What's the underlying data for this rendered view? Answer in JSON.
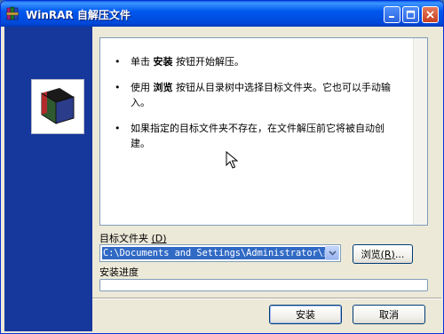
{
  "window": {
    "title": "WinRAR 自解压文件",
    "accent": "#0058ee",
    "panel_color": "#16389c",
    "icons": {
      "app": "winrar-books-icon",
      "minimize": "minimize-icon",
      "maximize": "maximize-icon",
      "close": "close-icon",
      "logo": "winrar-box-logo"
    }
  },
  "info": {
    "bullet": "•",
    "items": [
      {
        "before": "单击 ",
        "bold": "安装",
        "after": " 按钮开始解压。"
      },
      {
        "before": "使用 ",
        "bold": "浏览",
        "after": " 按钮从目录树中选择目标文件夹。它也可以手动输入。"
      },
      {
        "before": "如果指定的目标文件夹不存在，在文件解压前它将被自动创建。",
        "bold": "",
        "after": ""
      }
    ]
  },
  "destination": {
    "label": "目标文件夹",
    "label_hotkey": "(D)",
    "path": "C:\\Documents and Settings\\Administrator\\桌面"
  },
  "browse_button": {
    "label": "浏览",
    "hotkey": "(R)",
    "suffix": "..."
  },
  "progress": {
    "label": "安装进度",
    "value": 0
  },
  "buttons": {
    "install": "安装",
    "cancel": "取消"
  }
}
